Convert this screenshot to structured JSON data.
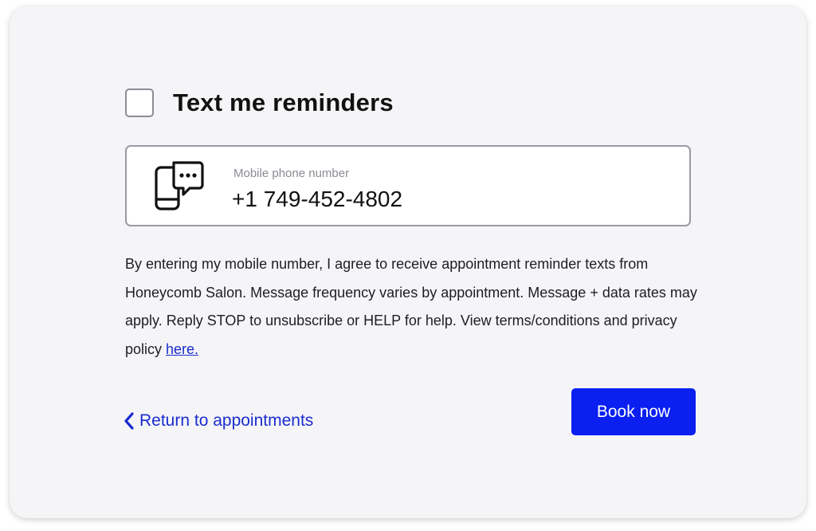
{
  "reminders": {
    "checked": false,
    "title": "Text me reminders"
  },
  "phone": {
    "icon": "phone-chat-icon",
    "label": "Mobile phone number",
    "value": "+1 749-452-4802"
  },
  "consent": {
    "text": "By entering my mobile number, I agree to receive appointment reminder texts from Honeycomb Salon. Message frequency varies by appointment. Message + data rates may apply. Reply STOP to unsubscribe or HELP for help. View terms/conditions and privacy policy ",
    "link_text": "here."
  },
  "actions": {
    "return_icon": "chevron-left-icon",
    "return_label": "Return to appointments",
    "book_label": "Book now"
  },
  "colors": {
    "accent": "#0a1ff0",
    "link": "#1a2ccf",
    "card_background": "#f5f5f8"
  }
}
